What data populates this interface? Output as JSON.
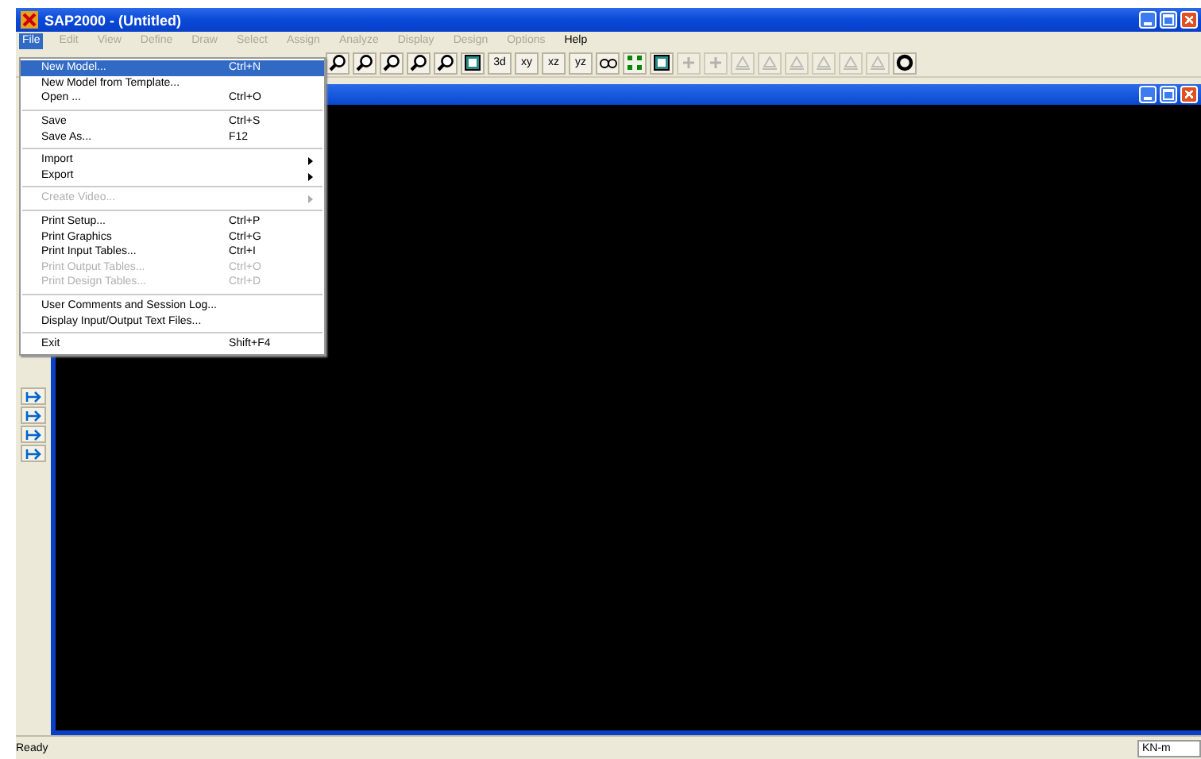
{
  "window": {
    "title": "SAP2000 - (Untitled)"
  },
  "menu_bar": [
    {
      "label": "File",
      "selected": true,
      "disabled": false
    },
    {
      "label": "Edit",
      "selected": false,
      "disabled": true
    },
    {
      "label": "View",
      "selected": false,
      "disabled": true
    },
    {
      "label": "Define",
      "selected": false,
      "disabled": true
    },
    {
      "label": "Draw",
      "selected": false,
      "disabled": true
    },
    {
      "label": "Select",
      "selected": false,
      "disabled": true
    },
    {
      "label": "Assign",
      "selected": false,
      "disabled": true
    },
    {
      "label": "Analyze",
      "selected": false,
      "disabled": true
    },
    {
      "label": "Display",
      "selected": false,
      "disabled": true
    },
    {
      "label": "Design",
      "selected": false,
      "disabled": true
    },
    {
      "label": "Options",
      "selected": false,
      "disabled": true
    },
    {
      "label": "Help",
      "selected": false,
      "disabled": false
    }
  ],
  "file_menu": [
    {
      "kind": "item",
      "label": "New Model...",
      "shortcut": "Ctrl+N",
      "selected": true,
      "disabled": false,
      "submenu": false
    },
    {
      "kind": "item",
      "label": "New Model from Template...",
      "selected": false,
      "disabled": false,
      "submenu": false
    },
    {
      "kind": "item",
      "label": "Open ...",
      "shortcut": "Ctrl+O",
      "selected": false,
      "disabled": false,
      "submenu": false
    },
    {
      "kind": "separator"
    },
    {
      "kind": "item",
      "label": "Save",
      "shortcut": "Ctrl+S",
      "selected": false,
      "disabled": false,
      "submenu": false
    },
    {
      "kind": "item",
      "label": "Save As...",
      "shortcut": "F12",
      "selected": false,
      "disabled": false,
      "submenu": false
    },
    {
      "kind": "separator"
    },
    {
      "kind": "item",
      "label": "Import",
      "selected": false,
      "disabled": false,
      "submenu": true
    },
    {
      "kind": "item",
      "label": "Export",
      "selected": false,
      "disabled": false,
      "submenu": true
    },
    {
      "kind": "separator"
    },
    {
      "kind": "item",
      "label": "Create Video...",
      "selected": false,
      "disabled": true,
      "submenu": true
    },
    {
      "kind": "separator"
    },
    {
      "kind": "item",
      "label": "Print Setup...",
      "shortcut": "Ctrl+P",
      "selected": false,
      "disabled": false,
      "submenu": false
    },
    {
      "kind": "item",
      "label": "Print Graphics",
      "shortcut": "Ctrl+G",
      "selected": false,
      "disabled": false,
      "submenu": false
    },
    {
      "kind": "item",
      "label": "Print Input Tables...",
      "shortcut": "Ctrl+I",
      "selected": false,
      "disabled": false,
      "submenu": false
    },
    {
      "kind": "item",
      "label": "Print Output Tables...",
      "shortcut": "Ctrl+O",
      "selected": false,
      "disabled": true,
      "submenu": false
    },
    {
      "kind": "item",
      "label": "Print Design Tables...",
      "shortcut": "Ctrl+D",
      "selected": false,
      "disabled": true,
      "submenu": false
    },
    {
      "kind": "separator"
    },
    {
      "kind": "item",
      "label": "User Comments and Session Log...",
      "selected": false,
      "disabled": false,
      "submenu": false
    },
    {
      "kind": "item",
      "label": "Display Input/Output Text Files...",
      "selected": false,
      "disabled": false,
      "submenu": false
    },
    {
      "kind": "separator"
    },
    {
      "kind": "item",
      "label": "Exit",
      "shortcut": "Shift+F4",
      "selected": false,
      "disabled": false,
      "submenu": false
    }
  ],
  "toolbar": [
    {
      "kind": "magnifier",
      "disabled": false
    },
    {
      "kind": "magnifier",
      "disabled": false
    },
    {
      "kind": "magnifier",
      "disabled": false
    },
    {
      "kind": "magnifier",
      "disabled": false
    },
    {
      "kind": "magnifier",
      "disabled": false
    },
    {
      "kind": "frame",
      "disabled": false
    },
    {
      "kind": "label",
      "label": "3d",
      "disabled": false
    },
    {
      "kind": "label",
      "label": "xy",
      "disabled": false
    },
    {
      "kind": "label",
      "label": "xz",
      "disabled": false
    },
    {
      "kind": "label",
      "label": "yz",
      "disabled": false
    },
    {
      "kind": "glasses",
      "disabled": false
    },
    {
      "kind": "grid",
      "disabled": false
    },
    {
      "kind": "frame",
      "disabled": false
    },
    {
      "kind": "plus",
      "disabled": true
    },
    {
      "kind": "plus",
      "disabled": true
    },
    {
      "kind": "support",
      "disabled": true
    },
    {
      "kind": "support",
      "disabled": true
    },
    {
      "kind": "support",
      "disabled": true
    },
    {
      "kind": "support",
      "disabled": true
    },
    {
      "kind": "support",
      "disabled": true
    },
    {
      "kind": "support",
      "disabled": true
    },
    {
      "kind": "ring",
      "disabled": false
    }
  ],
  "status_bar": {
    "text": "Ready",
    "units": "KN-m"
  }
}
